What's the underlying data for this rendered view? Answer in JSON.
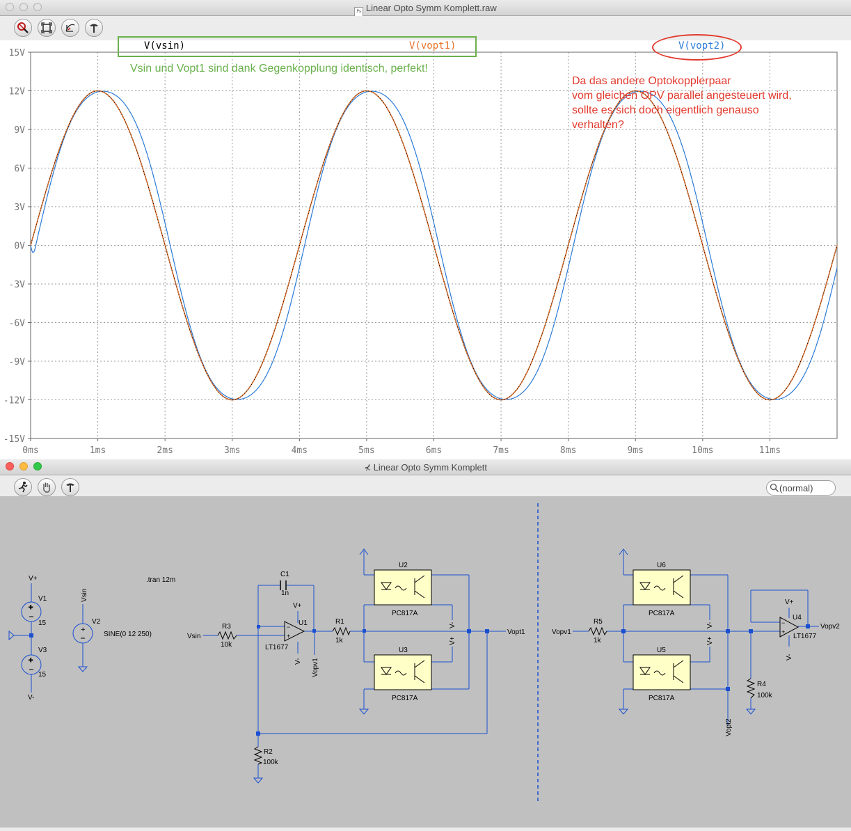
{
  "plot_window": {
    "title": "Linear Opto Symm Komplett.raw",
    "title_icon": "ps-document-icon",
    "toolbar": [
      "zoom-icon",
      "autorange-icon",
      "pick-trace-icon",
      "hammer-icon"
    ]
  },
  "schematic_window": {
    "title": "Linear Opto Symm Komplett",
    "title_icon": "schematic-symbol-icon",
    "toolbar": [
      "run-icon",
      "pan-hand-icon",
      "hammer-icon"
    ],
    "search_value": "(normal)"
  },
  "traces": {
    "vsin_label": "V(vsin)",
    "vopt1_label": "V(vopt1)",
    "vopt2_label": "V(vopt2)"
  },
  "annotations": {
    "green_note": "Vsin und Vopt1 sind dank Gegenkopplung identisch, perfekt!",
    "red_note_lines": [
      "Da das andere Optokopplerpaar",
      "vom gleichen OPV parallel angesteuert wird,",
      "sollte es sich doch eigentlich genauso",
      "verhalten?"
    ]
  },
  "colors": {
    "vsin": "#000000",
    "vopt1": "#e8732a",
    "vopt2": "#2b7bd6",
    "green_note": "#6ab04c",
    "red_note": "#e23b2e",
    "wire": "#1a4fd1"
  },
  "chart_data": {
    "type": "line",
    "x_unit": "ms",
    "y_unit": "V",
    "x_ticks": [
      "0ms",
      "1ms",
      "2ms",
      "3ms",
      "4ms",
      "5ms",
      "6ms",
      "7ms",
      "8ms",
      "9ms",
      "10ms",
      "11ms"
    ],
    "y_ticks": [
      "15V",
      "12V",
      "9V",
      "6V",
      "3V",
      "0V",
      "-3V",
      "-6V",
      "-9V",
      "-12V",
      "-15V"
    ],
    "xlim": [
      0,
      12
    ],
    "ylim": [
      -15,
      15
    ],
    "grid": true,
    "series": [
      {
        "name": "V(vsin)",
        "model": "sine",
        "amplitude": 12.0,
        "frequency_hz": 250,
        "stroke": "#000000"
      },
      {
        "name": "V(vopt1)",
        "model": "sine",
        "amplitude": 12.0,
        "frequency_hz": 250,
        "stroke": "#e8732a"
      },
      {
        "name": "V(vopt2)",
        "model": "sine-distorted",
        "amplitude": 12.6,
        "frequency_hz": 250,
        "stroke": "#2b7bd6"
      }
    ]
  },
  "schematic": {
    "labels": {
      "vplus_top": "V+",
      "v1": "V1",
      "v1_val": "15",
      "v3": "V3",
      "v3_val": "15",
      "vminus_bottom": "V-",
      "vsin_net": "Vsin",
      "v2": "V2",
      "v2_val": "SINE(0 12 250)",
      "tran": ".tran 12m",
      "c1": "C1",
      "c1_val": "1n",
      "r3": "R3",
      "r3_val": "10k",
      "vsin_in": "Vsin",
      "u1": "U1",
      "u1_model": "LT1677",
      "u1_vplus": "V+",
      "u1_vminus": "V-",
      "vopv1_net": "Vopv1",
      "r1": "R1",
      "r1_val": "1k",
      "u2": "U2",
      "u2_model": "PC817A",
      "u3": "U3",
      "u3_model": "PC817A",
      "u2_vminus": "V-",
      "u3_vplus": "V+",
      "vopt1_net": "Vopt1",
      "r2": "R2",
      "r2_val": "100k",
      "vopv1_in": "Vopv1",
      "r5": "R5",
      "r5_val": "1k",
      "u6": "U6",
      "u6_model": "PC817A",
      "u5": "U5",
      "u5_model": "PC817A",
      "u6_vminus": "V-",
      "u5_vplus": "V+",
      "vopt2_net": "Vopt2",
      "r4": "R4",
      "r4_val": "100k",
      "u4": "U4",
      "u4_model": "LT1677",
      "u4_vplus": "V+",
      "u4_vminus": "V-",
      "vopv2_net": "Vopv2"
    }
  }
}
